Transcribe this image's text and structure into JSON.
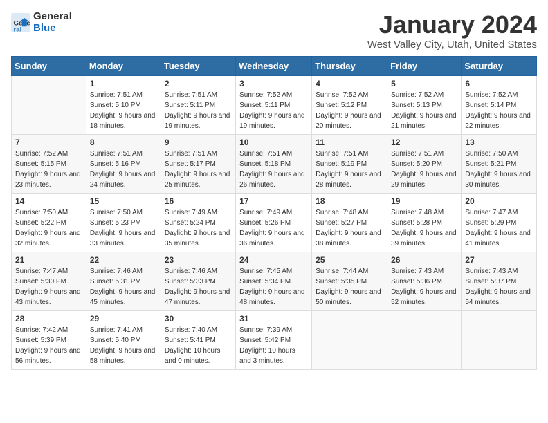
{
  "logo": {
    "general": "General",
    "blue": "Blue"
  },
  "title": "January 2024",
  "subtitle": "West Valley City, Utah, United States",
  "headers": [
    "Sunday",
    "Monday",
    "Tuesday",
    "Wednesday",
    "Thursday",
    "Friday",
    "Saturday"
  ],
  "weeks": [
    [
      {
        "day": "",
        "sunrise": "",
        "sunset": "",
        "daylight": ""
      },
      {
        "day": "1",
        "sunrise": "Sunrise: 7:51 AM",
        "sunset": "Sunset: 5:10 PM",
        "daylight": "Daylight: 9 hours and 18 minutes."
      },
      {
        "day": "2",
        "sunrise": "Sunrise: 7:51 AM",
        "sunset": "Sunset: 5:11 PM",
        "daylight": "Daylight: 9 hours and 19 minutes."
      },
      {
        "day": "3",
        "sunrise": "Sunrise: 7:52 AM",
        "sunset": "Sunset: 5:11 PM",
        "daylight": "Daylight: 9 hours and 19 minutes."
      },
      {
        "day": "4",
        "sunrise": "Sunrise: 7:52 AM",
        "sunset": "Sunset: 5:12 PM",
        "daylight": "Daylight: 9 hours and 20 minutes."
      },
      {
        "day": "5",
        "sunrise": "Sunrise: 7:52 AM",
        "sunset": "Sunset: 5:13 PM",
        "daylight": "Daylight: 9 hours and 21 minutes."
      },
      {
        "day": "6",
        "sunrise": "Sunrise: 7:52 AM",
        "sunset": "Sunset: 5:14 PM",
        "daylight": "Daylight: 9 hours and 22 minutes."
      }
    ],
    [
      {
        "day": "7",
        "sunrise": "Sunrise: 7:52 AM",
        "sunset": "Sunset: 5:15 PM",
        "daylight": "Daylight: 9 hours and 23 minutes."
      },
      {
        "day": "8",
        "sunrise": "Sunrise: 7:51 AM",
        "sunset": "Sunset: 5:16 PM",
        "daylight": "Daylight: 9 hours and 24 minutes."
      },
      {
        "day": "9",
        "sunrise": "Sunrise: 7:51 AM",
        "sunset": "Sunset: 5:17 PM",
        "daylight": "Daylight: 9 hours and 25 minutes."
      },
      {
        "day": "10",
        "sunrise": "Sunrise: 7:51 AM",
        "sunset": "Sunset: 5:18 PM",
        "daylight": "Daylight: 9 hours and 26 minutes."
      },
      {
        "day": "11",
        "sunrise": "Sunrise: 7:51 AM",
        "sunset": "Sunset: 5:19 PM",
        "daylight": "Daylight: 9 hours and 28 minutes."
      },
      {
        "day": "12",
        "sunrise": "Sunrise: 7:51 AM",
        "sunset": "Sunset: 5:20 PM",
        "daylight": "Daylight: 9 hours and 29 minutes."
      },
      {
        "day": "13",
        "sunrise": "Sunrise: 7:50 AM",
        "sunset": "Sunset: 5:21 PM",
        "daylight": "Daylight: 9 hours and 30 minutes."
      }
    ],
    [
      {
        "day": "14",
        "sunrise": "Sunrise: 7:50 AM",
        "sunset": "Sunset: 5:22 PM",
        "daylight": "Daylight: 9 hours and 32 minutes."
      },
      {
        "day": "15",
        "sunrise": "Sunrise: 7:50 AM",
        "sunset": "Sunset: 5:23 PM",
        "daylight": "Daylight: 9 hours and 33 minutes."
      },
      {
        "day": "16",
        "sunrise": "Sunrise: 7:49 AM",
        "sunset": "Sunset: 5:24 PM",
        "daylight": "Daylight: 9 hours and 35 minutes."
      },
      {
        "day": "17",
        "sunrise": "Sunrise: 7:49 AM",
        "sunset": "Sunset: 5:26 PM",
        "daylight": "Daylight: 9 hours and 36 minutes."
      },
      {
        "day": "18",
        "sunrise": "Sunrise: 7:48 AM",
        "sunset": "Sunset: 5:27 PM",
        "daylight": "Daylight: 9 hours and 38 minutes."
      },
      {
        "day": "19",
        "sunrise": "Sunrise: 7:48 AM",
        "sunset": "Sunset: 5:28 PM",
        "daylight": "Daylight: 9 hours and 39 minutes."
      },
      {
        "day": "20",
        "sunrise": "Sunrise: 7:47 AM",
        "sunset": "Sunset: 5:29 PM",
        "daylight": "Daylight: 9 hours and 41 minutes."
      }
    ],
    [
      {
        "day": "21",
        "sunrise": "Sunrise: 7:47 AM",
        "sunset": "Sunset: 5:30 PM",
        "daylight": "Daylight: 9 hours and 43 minutes."
      },
      {
        "day": "22",
        "sunrise": "Sunrise: 7:46 AM",
        "sunset": "Sunset: 5:31 PM",
        "daylight": "Daylight: 9 hours and 45 minutes."
      },
      {
        "day": "23",
        "sunrise": "Sunrise: 7:46 AM",
        "sunset": "Sunset: 5:33 PM",
        "daylight": "Daylight: 9 hours and 47 minutes."
      },
      {
        "day": "24",
        "sunrise": "Sunrise: 7:45 AM",
        "sunset": "Sunset: 5:34 PM",
        "daylight": "Daylight: 9 hours and 48 minutes."
      },
      {
        "day": "25",
        "sunrise": "Sunrise: 7:44 AM",
        "sunset": "Sunset: 5:35 PM",
        "daylight": "Daylight: 9 hours and 50 minutes."
      },
      {
        "day": "26",
        "sunrise": "Sunrise: 7:43 AM",
        "sunset": "Sunset: 5:36 PM",
        "daylight": "Daylight: 9 hours and 52 minutes."
      },
      {
        "day": "27",
        "sunrise": "Sunrise: 7:43 AM",
        "sunset": "Sunset: 5:37 PM",
        "daylight": "Daylight: 9 hours and 54 minutes."
      }
    ],
    [
      {
        "day": "28",
        "sunrise": "Sunrise: 7:42 AM",
        "sunset": "Sunset: 5:39 PM",
        "daylight": "Daylight: 9 hours and 56 minutes."
      },
      {
        "day": "29",
        "sunrise": "Sunrise: 7:41 AM",
        "sunset": "Sunset: 5:40 PM",
        "daylight": "Daylight: 9 hours and 58 minutes."
      },
      {
        "day": "30",
        "sunrise": "Sunrise: 7:40 AM",
        "sunset": "Sunset: 5:41 PM",
        "daylight": "Daylight: 10 hours and 0 minutes."
      },
      {
        "day": "31",
        "sunrise": "Sunrise: 7:39 AM",
        "sunset": "Sunset: 5:42 PM",
        "daylight": "Daylight: 10 hours and 3 minutes."
      },
      {
        "day": "",
        "sunrise": "",
        "sunset": "",
        "daylight": ""
      },
      {
        "day": "",
        "sunrise": "",
        "sunset": "",
        "daylight": ""
      },
      {
        "day": "",
        "sunrise": "",
        "sunset": "",
        "daylight": ""
      }
    ]
  ]
}
